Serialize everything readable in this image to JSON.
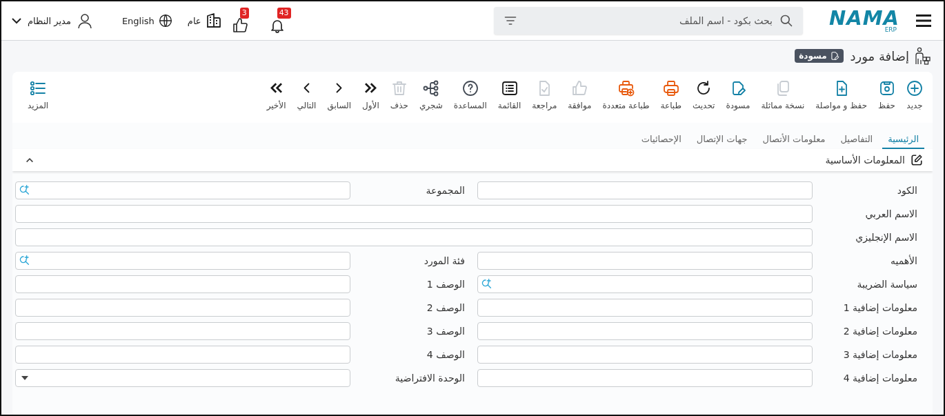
{
  "header": {
    "logo": {
      "name": "NAMA",
      "sub": "ERP"
    },
    "search": {
      "placeholder": "بحث بكود - اسم الملف"
    },
    "notifications": {
      "count": "43"
    },
    "likes": {
      "count": "3"
    },
    "company": "عام",
    "language": "English",
    "user": "مدير النظام"
  },
  "page": {
    "title": "إضافة مورد",
    "status": "مسودة"
  },
  "toolbar": [
    {
      "label": "جديد",
      "color": "#1381a6",
      "disabled": false
    },
    {
      "label": "حفظ",
      "color": "#1381a6",
      "disabled": false
    },
    {
      "label": "حفظ و مواصلة",
      "color": "#1381a6",
      "disabled": false
    },
    {
      "label": "نسخة مماثلة",
      "disabled": true
    },
    {
      "label": "مسودة",
      "color": "#1381a6",
      "disabled": false
    },
    {
      "label": "تحديث",
      "color": "#1b1b1b",
      "disabled": false
    },
    {
      "label": "طباعة",
      "color": "#e8590c",
      "disabled": false
    },
    {
      "label": "طباعة متعددة",
      "color": "#e8590c",
      "disabled": false
    },
    {
      "label": "موافقة",
      "disabled": true
    },
    {
      "label": "مراجعة",
      "disabled": true
    },
    {
      "label": "القائمة",
      "color": "#1b1b1b",
      "disabled": false
    },
    {
      "label": "المساعدة",
      "color": "#444b55",
      "disabled": false
    },
    {
      "label": "شجري",
      "color": "#444b55",
      "disabled": false
    },
    {
      "label": "حذف",
      "disabled": true
    },
    {
      "label": "الأول",
      "color": "#1b1b1b",
      "disabled": false
    },
    {
      "label": "السابق",
      "color": "#1b1b1b",
      "disabled": false
    },
    {
      "label": "التالي",
      "color": "#1b1b1b",
      "disabled": false
    },
    {
      "label": "الأخير",
      "color": "#1b1b1b",
      "disabled": false
    }
  ],
  "more": {
    "label": "المزيد",
    "color": "#1381a6",
    "disabled": false
  },
  "tabs": [
    {
      "label": "الرئيسية",
      "selected": true
    },
    {
      "label": "التفاصيل",
      "selected": false
    },
    {
      "label": "معلومات الأتصال",
      "selected": false
    },
    {
      "label": "جهات الإتصال",
      "selected": false
    },
    {
      "label": "الإحصائيات",
      "selected": false
    }
  ],
  "section": {
    "title": "المعلومات الأساسية",
    "expanded": true
  },
  "form": [
    {
      "cells": [
        {
          "label": "الكود",
          "kind": "text"
        },
        {
          "label": "المجموعة",
          "kind": "lookup"
        }
      ]
    },
    {
      "cells": [
        {
          "label": "الاسم العربي",
          "kind": "text"
        }
      ]
    },
    {
      "cells": [
        {
          "label": "الاسم الإنجليزي",
          "kind": "text"
        }
      ]
    },
    {
      "cells": [
        {
          "label": "الأهميه",
          "kind": "text"
        },
        {
          "label": "فئة المورد",
          "kind": "lookup"
        }
      ]
    },
    {
      "cells": [
        {
          "label": "سياسة الضريبة",
          "kind": "lookup"
        },
        {
          "label": "الوصف 1",
          "kind": "text"
        }
      ]
    },
    {
      "cells": [
        {
          "label": "معلومات إضافية 1",
          "kind": "text"
        },
        {
          "label": "الوصف 2",
          "kind": "text"
        }
      ]
    },
    {
      "cells": [
        {
          "label": "معلومات إضافية 2",
          "kind": "text"
        },
        {
          "label": "الوصف 3",
          "kind": "text"
        }
      ]
    },
    {
      "cells": [
        {
          "label": "معلومات إضافية 3",
          "kind": "text"
        },
        {
          "label": "الوصف 4",
          "kind": "text"
        }
      ]
    },
    {
      "cells": [
        {
          "label": "معلومات إضافية 4",
          "kind": "text"
        },
        {
          "label": "الوحدة الافتراضية",
          "kind": "select"
        }
      ]
    }
  ]
}
